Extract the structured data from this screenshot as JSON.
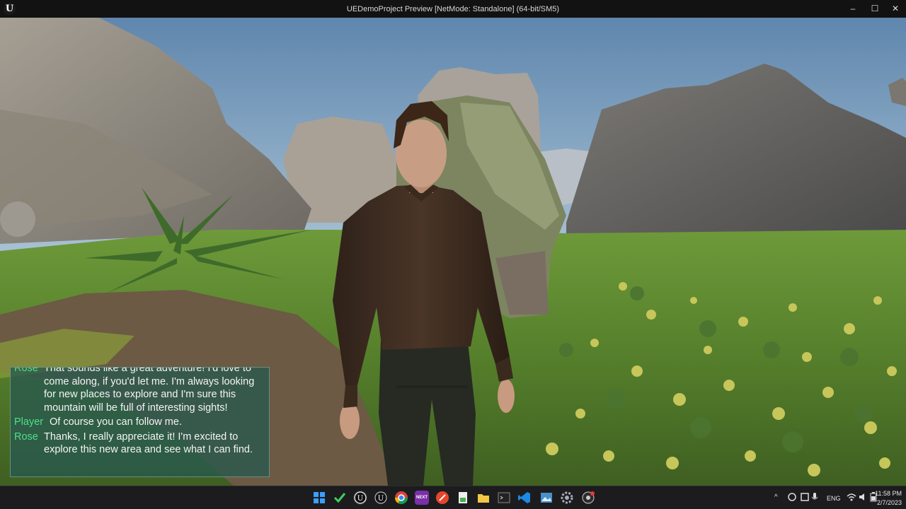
{
  "window": {
    "title": "UEDemoProject Preview [NetMode: Standalone]  (64-bit/SM5)",
    "logo_text": "U",
    "minimize": "–",
    "maximize": "☐",
    "close": "✕"
  },
  "dialogue": [
    {
      "speaker": "Rose",
      "text": "That sounds like a great adventure! I'd love to come along, if you'd let me. I'm always looking for new places to explore and I'm sure this mountain will be full of interesting sights!"
    },
    {
      "speaker": "Player",
      "text": "Of course you can follow me."
    },
    {
      "speaker": "Rose",
      "text": "Thanks, I really appreciate it! I'm excited to explore this new area and see what I can find."
    }
  ],
  "colors": {
    "speaker": "#4fe08a",
    "dialog_bg": "#28584e",
    "taskbar": "#1c1c1f"
  },
  "taskbar": {
    "apps": [
      "windows-start",
      "checkmark-app",
      "unreal-engine",
      "unreal-engine-2",
      "chrome",
      "next-app",
      "red-app",
      "notes-app",
      "file-explorer",
      "terminal",
      "vscode",
      "image-viewer",
      "settings",
      "obs"
    ],
    "next_label": "NEXT",
    "tray": {
      "language": "ENG",
      "time": "11:58 PM",
      "date": "2/7/2023",
      "chevron": "^"
    }
  }
}
